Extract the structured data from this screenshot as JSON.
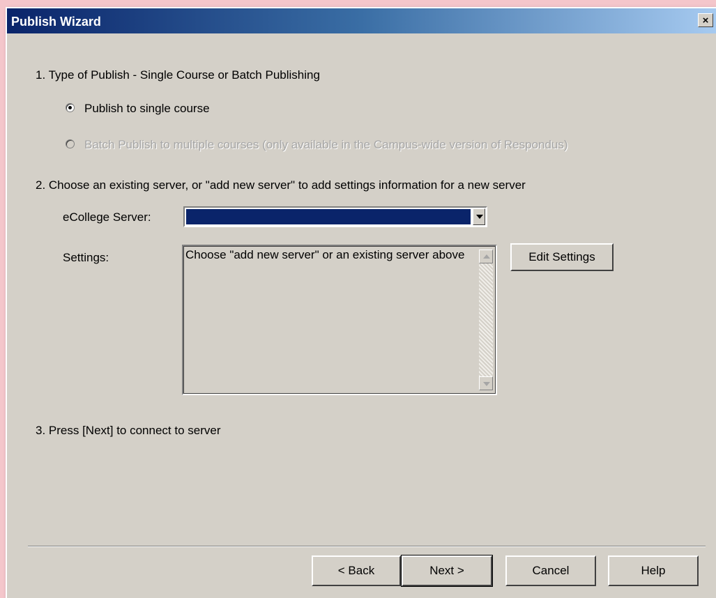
{
  "window": {
    "title": "Publish Wizard",
    "close_glyph": "×"
  },
  "step1": {
    "heading": "1.  Type of Publish - Single Course or Batch Publishing",
    "option_single": "Publish to single course",
    "option_batch": "Batch Publish to multiple courses (only available in the Campus-wide version of Respondus)",
    "selected": "single"
  },
  "step2": {
    "heading": "2.  Choose an existing server, or \"add new server\" to add settings information for a new server",
    "server_label": "eCollege Server:",
    "server_value": "",
    "settings_label": "Settings:",
    "settings_text": "Choose \"add new server\" or an existing server above",
    "edit_button": "Edit Settings"
  },
  "step3": {
    "heading": "3.  Press [Next] to connect to server"
  },
  "buttons": {
    "back": "< Back",
    "next": "Next >",
    "cancel": "Cancel",
    "help": "Help"
  },
  "colors": {
    "titlebar_start": "#0a246a",
    "titlebar_end": "#a6caf0",
    "dialog_face": "#d4d0c8",
    "selection": "#0a246a"
  }
}
